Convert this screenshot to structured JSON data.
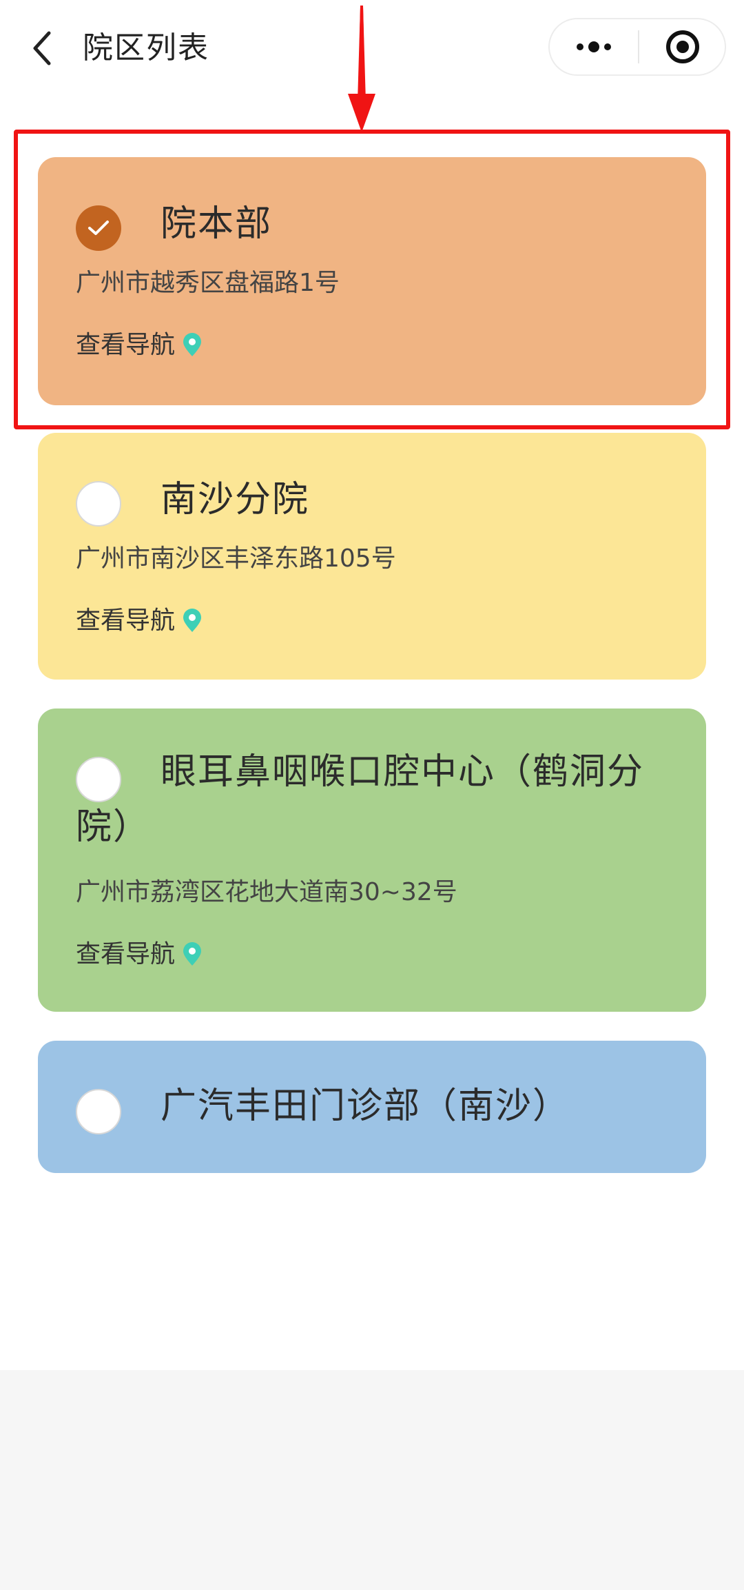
{
  "header": {
    "title": "院区列表",
    "back_icon": "chevron-left-icon",
    "more_icon": "more-dots-icon",
    "close_icon": "target-circle-icon"
  },
  "campuses": [
    {
      "name": "院本部",
      "address": "广州市越秀区盘福路1号",
      "nav_label": "查看导航",
      "selected": true,
      "color": "#f0b483"
    },
    {
      "name": "南沙分院",
      "address": "广州市南沙区丰泽东路105号",
      "nav_label": "查看导航",
      "selected": false,
      "color": "#fce696"
    },
    {
      "name": "眼耳鼻咽喉口腔中心（鹤洞分院）",
      "address": "广州市荔湾区花地大道南30~32号",
      "nav_label": "查看导航",
      "selected": false,
      "color": "#a9d18e"
    },
    {
      "name": "广汽丰田门诊部（南沙）",
      "selected": false,
      "color": "#9cc3e5"
    }
  ],
  "colors": {
    "selected_radio": "#c26420",
    "pin": "#3ecfb6",
    "annotation": "#f01414"
  }
}
